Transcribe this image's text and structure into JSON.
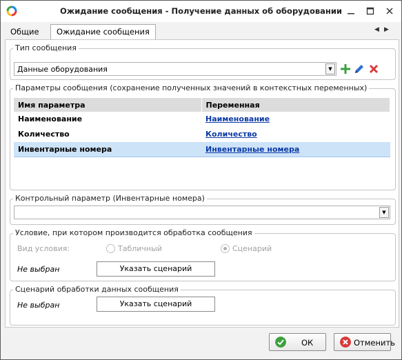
{
  "window": {
    "title": "Ожидание сообщения - Получение данных об оборудовании",
    "minimize_icon": "minimize-icon",
    "maximize_icon": "maximize-icon",
    "close_icon": "close-icon"
  },
  "tabs": {
    "items": [
      "Общие",
      "Ожидание сообщения"
    ],
    "active": "Ожидание сообщения"
  },
  "message_type": {
    "legend": "Тип сообщения",
    "selected": "Данные оборудования"
  },
  "params": {
    "legend": "Параметры сообщения (сохранение полученных значений в контекстных переменных)",
    "columns": [
      "Имя параметра",
      "Переменная"
    ],
    "rows": [
      {
        "name": "Наименование",
        "var": "Наименование"
      },
      {
        "name": "Количество",
        "var": "Количество"
      },
      {
        "name": "Инвентарные номера",
        "var": "Инвентарные номера"
      }
    ],
    "selected_row": 2
  },
  "control": {
    "legend": "Контрольный параметр (Инвентарные номера)",
    "value": ""
  },
  "condition": {
    "legend": "Условие, при котором производится обработка сообщения",
    "type_label": "Вид условия:",
    "option_table": "Табличный",
    "option_scenario": "Сценарий",
    "selected_option": "Сценарий",
    "status": "Не выбран",
    "button": "Указать сценарий"
  },
  "scenario": {
    "legend": "Сценарий обработки данных сообщения",
    "status": "Не выбран",
    "button": "Указать сценарий"
  },
  "footer": {
    "ok": "ОК",
    "cancel": "Отменить"
  },
  "colors": {
    "accent_green": "#3da03d",
    "cancel_red": "#d83a3a",
    "selection": "#cde3f8",
    "link": "#0b3aa6"
  }
}
